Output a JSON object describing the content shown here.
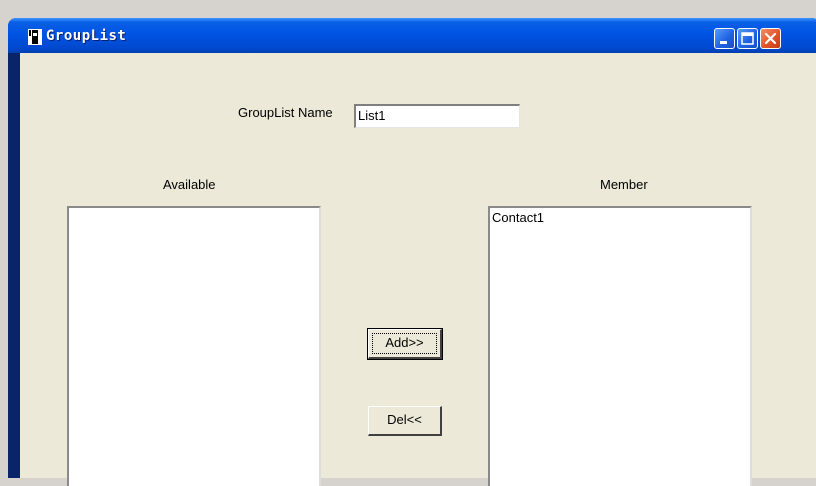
{
  "window": {
    "title": "GroupList"
  },
  "form": {
    "name_label": "GroupList Name",
    "name_value": "List1",
    "available_label": "Available",
    "member_label": "Member",
    "available_items": [],
    "member_items": [
      "Contact1"
    ],
    "add_label": "Add>>",
    "del_label": "Del<<"
  }
}
